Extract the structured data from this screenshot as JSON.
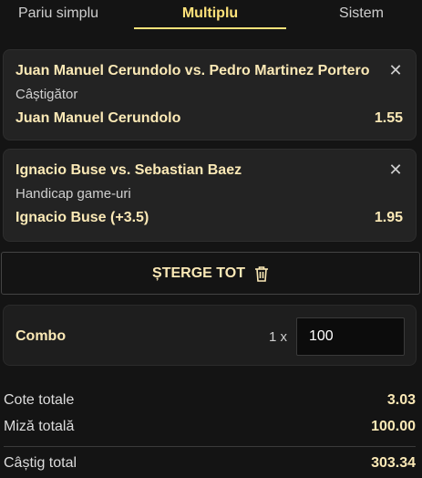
{
  "tabs": [
    {
      "label": "Pariu simplu",
      "active": false
    },
    {
      "label": "Multiplu",
      "active": true
    },
    {
      "label": "Sistem",
      "active": false
    }
  ],
  "bets": [
    {
      "match": "Juan Manuel Cerundolo vs. Pedro Martinez Portero",
      "market": "Câștigător",
      "selection": "Juan Manuel Cerundolo",
      "odd": "1.55",
      "close_icon": "close-icon"
    },
    {
      "match": "Ignacio Buse vs. Sebastian Baez",
      "market": "Handicap game-uri",
      "selection": "Ignacio Buse (+3.5)",
      "odd": "1.95",
      "close_icon": "close-icon"
    }
  ],
  "clear_button": {
    "label": "ȘTERGE TOT",
    "icon": "trash-icon"
  },
  "combo": {
    "label": "Combo",
    "multiplier": "1 x",
    "stake": "100"
  },
  "summary": {
    "total_odds_label": "Cote totale",
    "total_odds_value": "3.03",
    "total_stake_label": "Miză totală",
    "total_stake_value": "100.00",
    "total_win_label": "Câștig total",
    "total_win_value": "303.34"
  },
  "colors": {
    "accent": "#ffe37a",
    "text_highlight": "#fbe9b6",
    "background": "#141414",
    "card": "#232323"
  }
}
